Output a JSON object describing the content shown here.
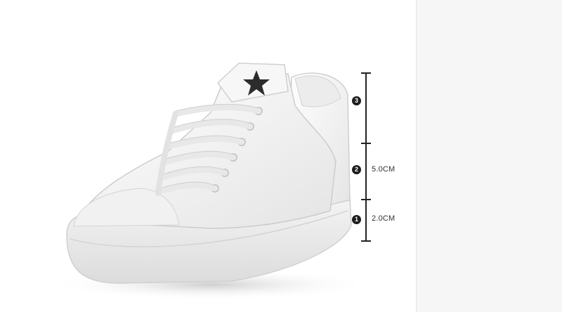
{
  "colors": {
    "background": "#ffffff",
    "panel": "#f6f6f6",
    "ruler": "#222222"
  },
  "image": {
    "subject": "white-sneaker-with-black-star-icon"
  },
  "ruler": {
    "markers": [
      {
        "label": "3"
      },
      {
        "label": "2",
        "measurement": "5.0CM"
      },
      {
        "label": "1",
        "measurement": "2.0CM"
      }
    ]
  }
}
